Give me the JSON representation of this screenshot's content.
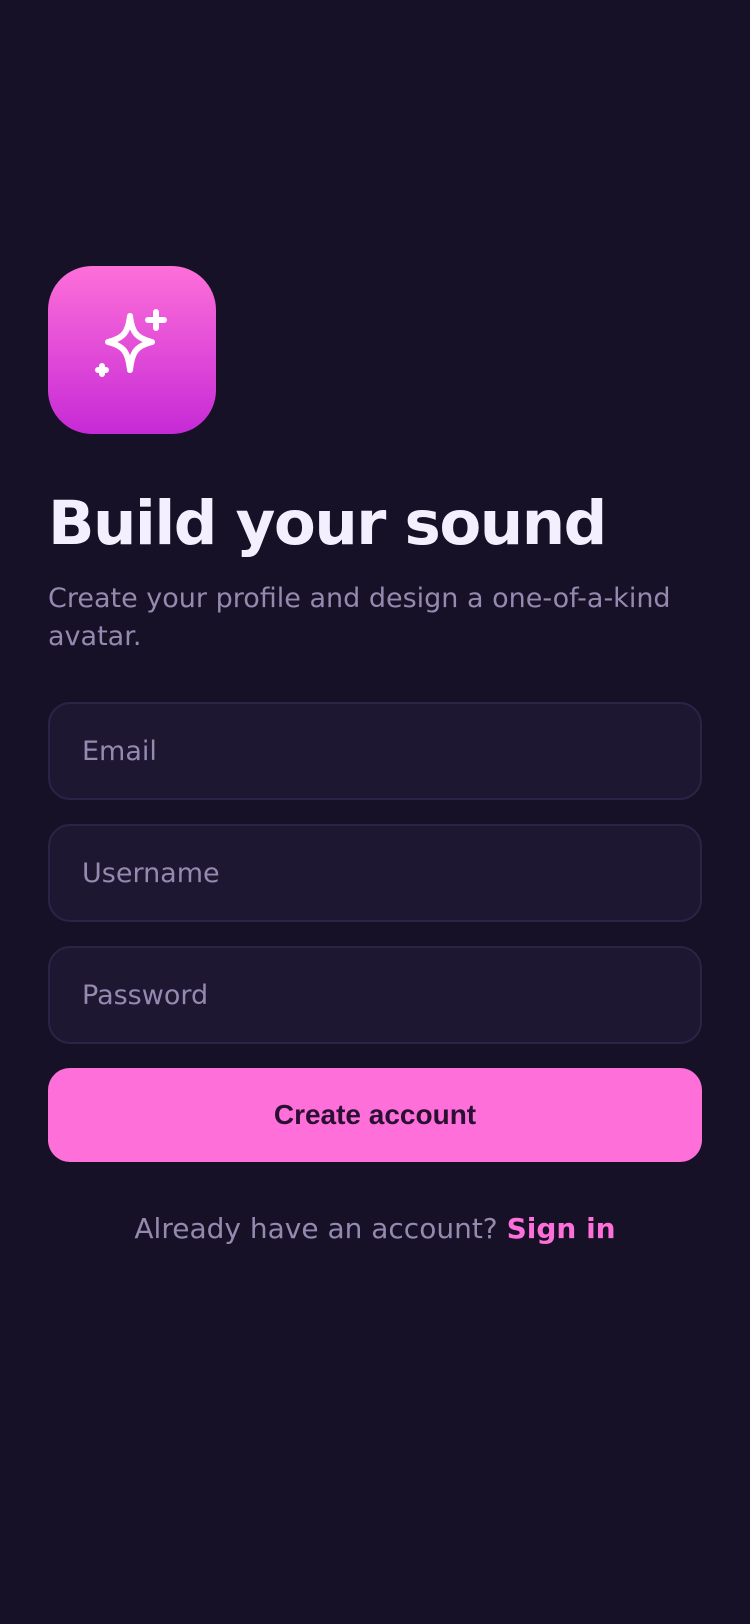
{
  "app_icon": {
    "icon": "sparkles-icon",
    "gradient_top": "#fe6fd9",
    "gradient_bottom": "#c62ad6"
  },
  "header": {
    "title": "Build your sound",
    "subtitle": "Create your profile and design a one-of-a-kind avatar."
  },
  "form": {
    "email_placeholder": "Email",
    "username_placeholder": "Username",
    "password_placeholder": "Password",
    "submit_label": "Create account"
  },
  "footer": {
    "prompt": "Already have an account?",
    "link_label": "Sign in"
  },
  "colors": {
    "background": "#161126",
    "accent": "#fe6fd9",
    "text_primary": "#f4efff",
    "text_secondary": "#948ab0",
    "field_bg": "#1e1731"
  }
}
